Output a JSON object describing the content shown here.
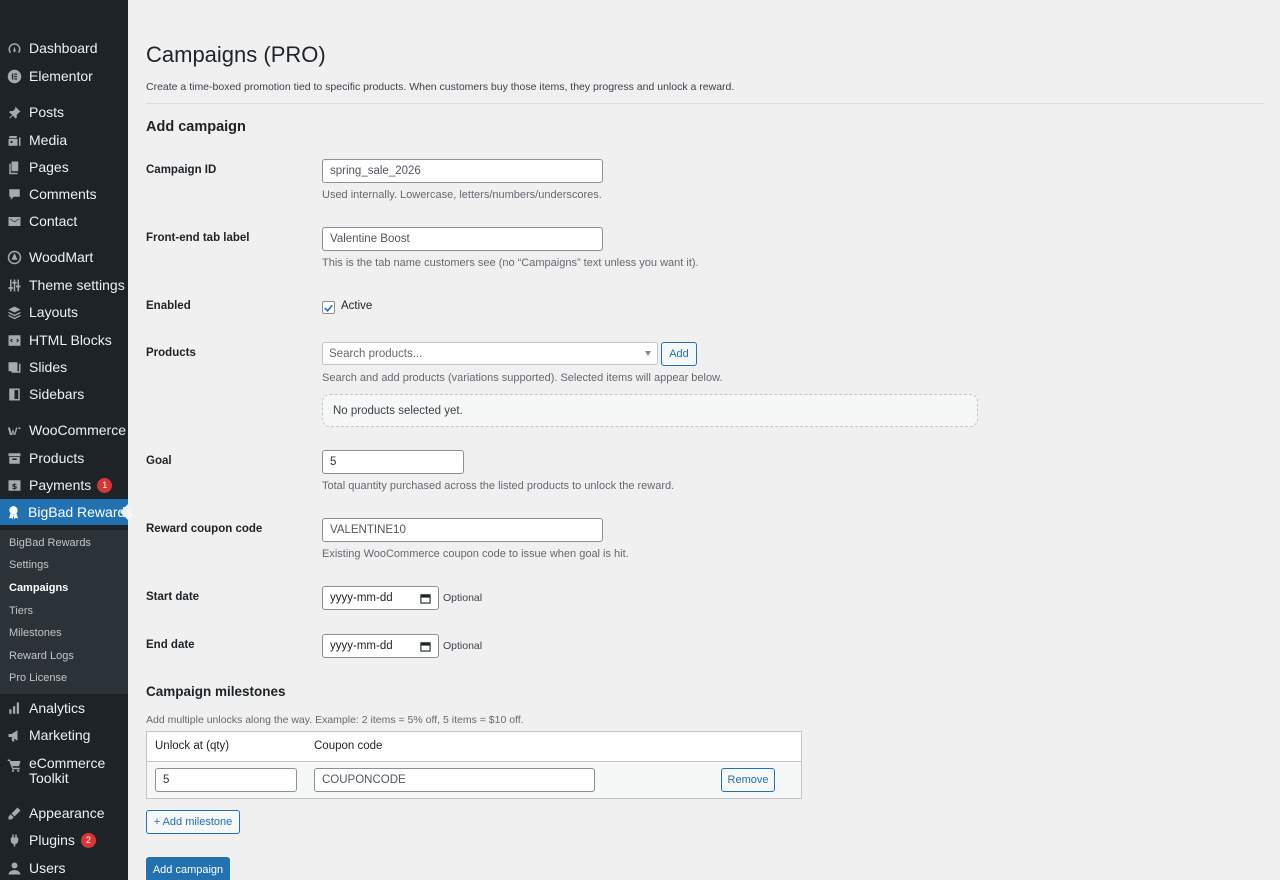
{
  "sidebar": {
    "items": [
      {
        "label": "Dashboard",
        "icon": "dashboard-icon"
      },
      {
        "label": "Elementor",
        "icon": "elementor-icon"
      },
      {
        "label": "Posts",
        "icon": "pin-icon"
      },
      {
        "label": "Media",
        "icon": "media-icon"
      },
      {
        "label": "Pages",
        "icon": "pages-icon"
      },
      {
        "label": "Comments",
        "icon": "comment-icon"
      },
      {
        "label": "Contact",
        "icon": "mail-icon"
      },
      {
        "label": "WoodMart",
        "icon": "woodmart-icon"
      },
      {
        "label": "Theme settings",
        "icon": "sliders-icon"
      },
      {
        "label": "Layouts",
        "icon": "layers-icon"
      },
      {
        "label": "HTML Blocks",
        "icon": "html-icon"
      },
      {
        "label": "Slides",
        "icon": "slides-icon"
      },
      {
        "label": "Sidebars",
        "icon": "sidebar-icon"
      },
      {
        "label": "WooCommerce",
        "icon": "woo-icon"
      },
      {
        "label": "Products",
        "icon": "archive-icon"
      },
      {
        "label": "Payments",
        "icon": "dollar-icon",
        "badge": "1"
      },
      {
        "label": "BigBad Rewards",
        "icon": "award-icon"
      },
      {
        "label": "Analytics",
        "icon": "bar-chart-icon"
      },
      {
        "label": "Marketing",
        "icon": "megaphone-icon"
      },
      {
        "label": "eCommerce Toolkit",
        "icon": "cart-icon"
      },
      {
        "label": "Appearance",
        "icon": "brush-icon"
      },
      {
        "label": "Plugins",
        "icon": "plug-icon",
        "badge": "2"
      },
      {
        "label": "Users",
        "icon": "user-icon"
      }
    ],
    "submenu": [
      "BigBad Rewards",
      "Settings",
      "Campaigns",
      "Tiers",
      "Milestones",
      "Reward Logs",
      "Pro License"
    ],
    "current_submenu": "Campaigns"
  },
  "page": {
    "title": "Campaigns (PRO)",
    "description": "Create a time-boxed promotion tied to specific products. When customers buy those items, they progress and unlock a reward."
  },
  "form": {
    "heading": "Add campaign",
    "campaign_id": {
      "label": "Campaign ID",
      "value": "",
      "placeholder": "spring_sale_2026",
      "help": "Used internally. Lowercase, letters/numbers/underscores."
    },
    "tab_label": {
      "label": "Front-end tab label",
      "value": "",
      "placeholder": "Valentine Boost",
      "help": "This is the tab name customers see (no “Campaigns” text unless you want it)."
    },
    "enabled": {
      "label": "Enabled",
      "checkbox_label": "Active",
      "checked": true
    },
    "products": {
      "label": "Products",
      "placeholder": "Search products...",
      "add_label": "Add",
      "help": "Search and add products (variations supported). Selected items will appear below.",
      "empty_text": "No products selected yet."
    },
    "goal": {
      "label": "Goal",
      "value": "5",
      "help": "Total quantity purchased across the listed products to unlock the reward."
    },
    "reward_coupon": {
      "label": "Reward coupon code",
      "value": "",
      "placeholder": "VALENTINE10",
      "help": "Existing WooCommerce coupon code to issue when goal is hit."
    },
    "start_date": {
      "label": "Start date",
      "placeholder": "yyyy-mm-dd",
      "note": "Optional"
    },
    "end_date": {
      "label": "End date",
      "placeholder": "yyyy-mm-dd",
      "note": "Optional"
    },
    "submit_label": "Add campaign"
  },
  "milestones": {
    "heading": "Campaign milestones",
    "help": "Add multiple unlocks along the way. Example: 2 items = 5% off, 5 items = $10 off.",
    "columns": [
      "Unlock at (qty)",
      "Coupon code"
    ],
    "rows": [
      {
        "qty": "5",
        "coupon": "",
        "coupon_placeholder": "COUPONCODE",
        "remove_label": "Remove"
      }
    ],
    "add_label": "+ Add milestone"
  },
  "colors": {
    "accent": "#2271b1",
    "sidebar_bg": "#1d2327",
    "badge": "#d63638"
  }
}
